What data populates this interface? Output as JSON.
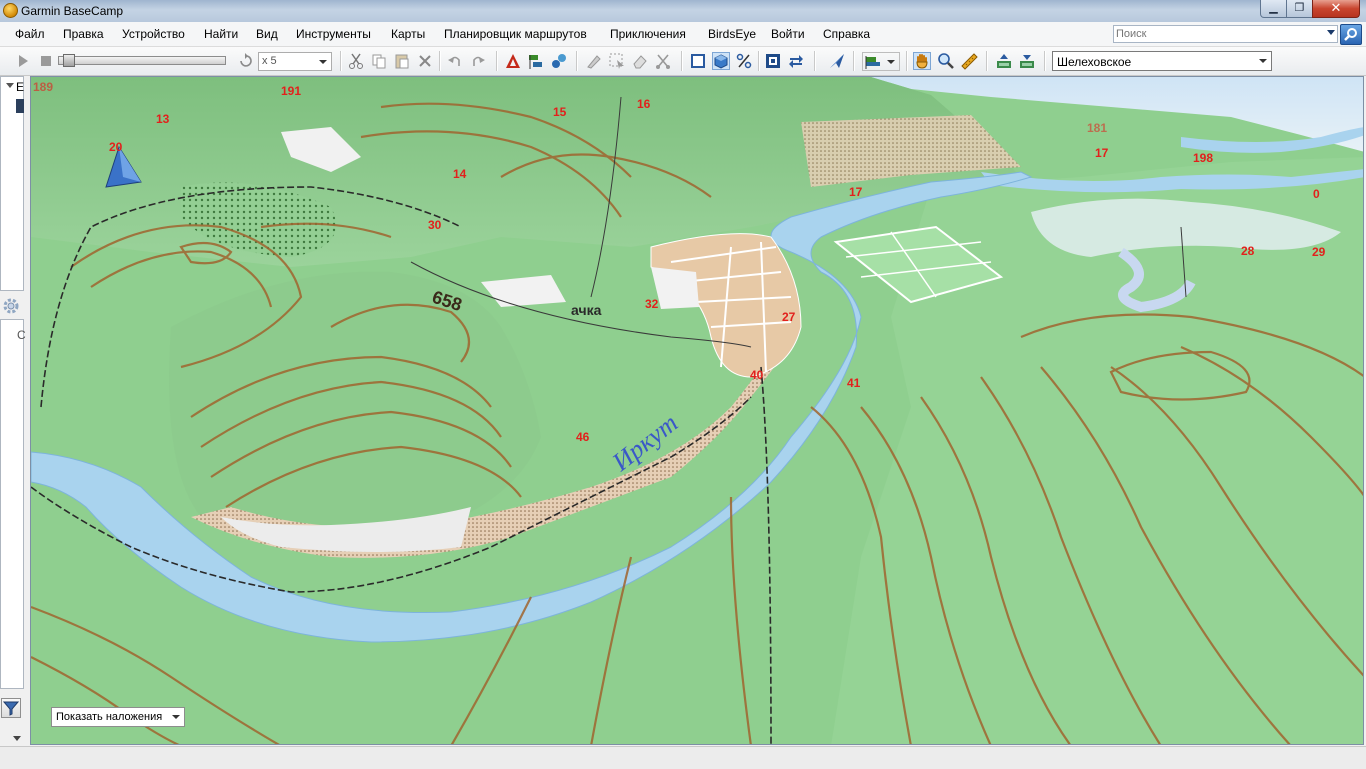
{
  "window": {
    "title": "Garmin BaseCamp"
  },
  "menu": [
    {
      "id": "file",
      "label": "Файл"
    },
    {
      "id": "edit",
      "label": "Правка"
    },
    {
      "id": "device",
      "label": "Устройство"
    },
    {
      "id": "find",
      "label": "Найти"
    },
    {
      "id": "view",
      "label": "Вид"
    },
    {
      "id": "tools",
      "label": "Инструменты"
    },
    {
      "id": "maps",
      "label": "Карты"
    },
    {
      "id": "route-planner",
      "label": "Планировщик маршрутов"
    },
    {
      "id": "adventures",
      "label": "Приключения"
    },
    {
      "id": "birdseye",
      "label": "BirdsEye"
    },
    {
      "id": "signin",
      "label": "Войти"
    },
    {
      "id": "help",
      "label": "Справка"
    }
  ],
  "search": {
    "placeholder": "Поиск",
    "value": ""
  },
  "toolbar": {
    "playback_speed": "x 5",
    "playback_position": 0.02,
    "map_selector": "Шелеховское",
    "icons": [
      "play-icon",
      "stop-icon",
      "replay-icon",
      "cut-icon",
      "copy-icon",
      "paste-icon",
      "delete-icon",
      "undo-icon",
      "redo-icon",
      "new-route-icon",
      "new-track-icon",
      "new-waypoint-icon",
      "draw-icon",
      "select-icon",
      "erase-icon",
      "divide-icon",
      "map-2d-icon",
      "map-3d-icon",
      "percent-icon",
      "fit-icon",
      "refresh-icon",
      "send-icon",
      "route-tool-icon",
      "hand-icon",
      "zoom-icon",
      "measure-icon",
      "receive-device-icon",
      "send-device-icon"
    ]
  },
  "left_panel": {
    "tree_label": "E",
    "detail_label": "C"
  },
  "map": {
    "overlay_button": "Показать наложения",
    "spot_elevations": [
      "189",
      "191",
      "13",
      "20",
      "15",
      "16",
      "14",
      "30",
      "17",
      "181",
      "17",
      "198",
      "0",
      "28",
      "29",
      "32",
      "27",
      "40",
      "41",
      "46"
    ],
    "peak_label": "658",
    "river_label": "Иркут",
    "stream_label": "ачка",
    "colors": {
      "terrain": "#8fcf8f",
      "water": "#a9d3ee",
      "contour": "#a0652f",
      "settlement": "#e7c9a6",
      "label_red": "#e2201c",
      "river_text": "#3a58c8"
    }
  }
}
